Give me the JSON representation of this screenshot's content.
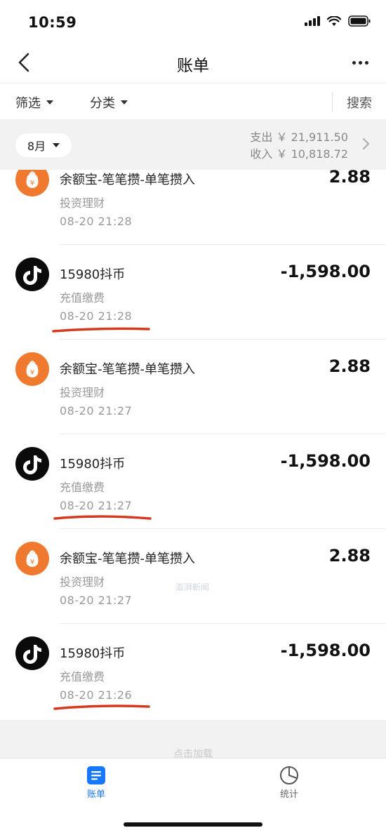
{
  "status_bar": {
    "time": "10:59"
  },
  "nav": {
    "title": "账单"
  },
  "filters": {
    "filter_label": "筛选",
    "category_label": "分类",
    "search_label": "搜索"
  },
  "summary": {
    "month": "8月",
    "expense": "支出 ￥ 21,911.50",
    "income": "收入 ￥ 10,818.72"
  },
  "transactions": [
    {
      "title": "余额宝-笔笔攒-单笔攒入",
      "category": "投资理财",
      "time": "08-20  21:28",
      "amount": "2.88",
      "icon": "yuebao-icon"
    },
    {
      "title": "15980抖币",
      "category": "充值缴费",
      "time": "08-20  21:28",
      "amount": "-1,598.00",
      "icon": "douyin-icon"
    },
    {
      "title": "余额宝-笔笔攒-单笔攒入",
      "category": "投资理财",
      "time": "08-20  21:27",
      "amount": "2.88",
      "icon": "yuebao-icon"
    },
    {
      "title": "15980抖币",
      "category": "充值缴费",
      "time": "08-20  21:27",
      "amount": "-1,598.00",
      "icon": "douyin-icon"
    },
    {
      "title": "余额宝-笔笔攒-单笔攒入",
      "category": "投资理财",
      "time": "08-20  21:27",
      "amount": "2.88",
      "icon": "yuebao-icon"
    },
    {
      "title": "15980抖币",
      "category": "充值缴费",
      "time": "08-20  21:26",
      "amount": "-1,598.00",
      "icon": "douyin-icon"
    }
  ],
  "watermark": "澎湃新闻",
  "load_more": "点击加载",
  "tabs": [
    {
      "label": "账单",
      "active": true
    },
    {
      "label": "统计",
      "active": false
    }
  ],
  "colors": {
    "accent": "#1677ff",
    "yuebao": "#ef7a2f",
    "douyin": "#0b0b0b",
    "annotation": "#d43a1f"
  }
}
